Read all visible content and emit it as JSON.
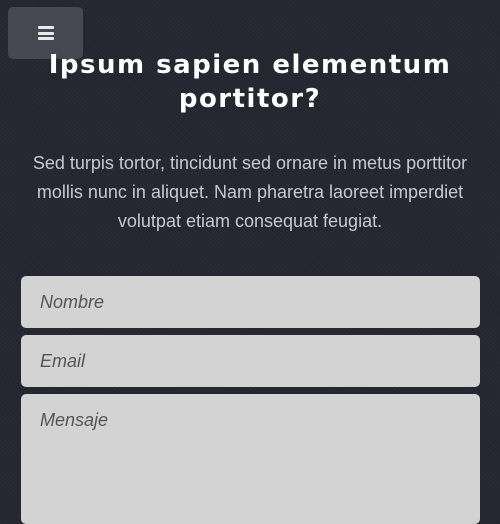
{
  "header": {
    "menu_icon": "hamburger-menu-icon",
    "title": "Ipsum sapien elementum portitor?"
  },
  "main": {
    "intro": "Sed turpis tortor, tincidunt sed ornare in metus porttitor mollis nunc in aliquet. Nam pharetra laoreet imperdiet volutpat etiam consequat feugiat."
  },
  "form": {
    "name_placeholder": "Nombre",
    "email_placeholder": "Email",
    "message_placeholder": "Mensaje"
  }
}
